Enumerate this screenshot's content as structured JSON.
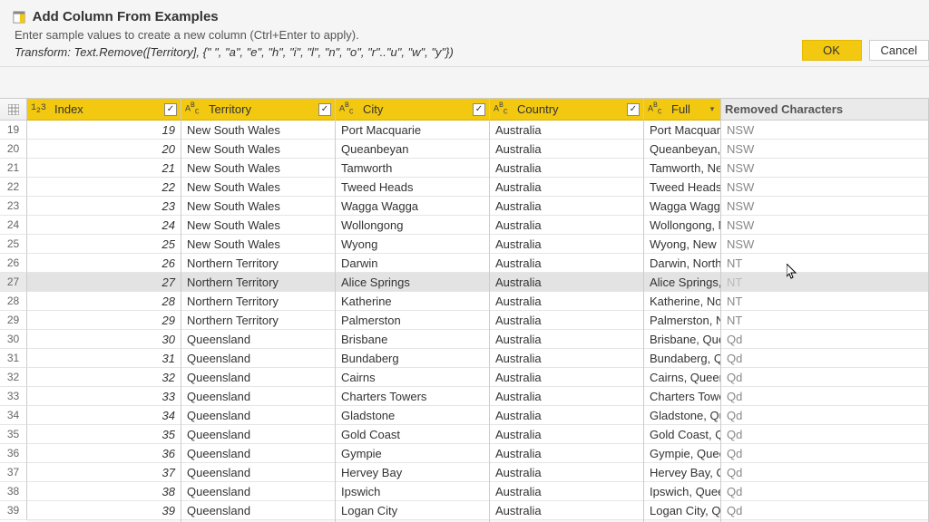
{
  "header": {
    "title": "Add Column From Examples",
    "subtitle": "Enter sample values to create a new column (Ctrl+Enter to apply).",
    "formula": "Transform: Text.Remove([Territory], {\" \", \"a\", \"e\", \"h\", \"i\", \"l\", \"n\", \"o\", \"r\"..\"u\", \"w\", \"y\"})"
  },
  "buttons": {
    "ok": "OK",
    "cancel": "Cancel"
  },
  "columns": {
    "index": {
      "label": "Index",
      "type": "123"
    },
    "terr": {
      "label": "Territory",
      "type": "ABC"
    },
    "city": {
      "label": "City",
      "type": "ABC"
    },
    "country": {
      "label": "Country",
      "type": "ABC"
    },
    "full": {
      "label": "Full",
      "type": "ABC"
    },
    "new": {
      "label": "Removed Characters"
    }
  },
  "chart_data": {
    "type": "table",
    "selected_row_index": 27,
    "rows": [
      {
        "n": 19,
        "idx": 19,
        "terr": "New South Wales",
        "city": "Port Macquarie",
        "country": "Australia",
        "full": "Port Macquarie",
        "new": "NSW"
      },
      {
        "n": 20,
        "idx": 20,
        "terr": "New South Wales",
        "city": "Queanbeyan",
        "country": "Australia",
        "full": "Queanbeyan, N",
        "new": "NSW"
      },
      {
        "n": 21,
        "idx": 21,
        "terr": "New South Wales",
        "city": "Tamworth",
        "country": "Australia",
        "full": "Tamworth, Ne",
        "new": "NSW"
      },
      {
        "n": 22,
        "idx": 22,
        "terr": "New South Wales",
        "city": "Tweed Heads",
        "country": "Australia",
        "full": "Tweed Heads,",
        "new": "NSW"
      },
      {
        "n": 23,
        "idx": 23,
        "terr": "New South Wales",
        "city": "Wagga Wagga",
        "country": "Australia",
        "full": "Wagga Wagga,",
        "new": "NSW"
      },
      {
        "n": 24,
        "idx": 24,
        "terr": "New South Wales",
        "city": "Wollongong",
        "country": "Australia",
        "full": "Wollongong, N",
        "new": "NSW"
      },
      {
        "n": 25,
        "idx": 25,
        "terr": "New South Wales",
        "city": "Wyong",
        "country": "Australia",
        "full": "Wyong, New S",
        "new": "NSW"
      },
      {
        "n": 26,
        "idx": 26,
        "terr": "Northern Territory",
        "city": "Darwin",
        "country": "Australia",
        "full": "Darwin, Northe",
        "new": "NT"
      },
      {
        "n": 27,
        "idx": 27,
        "terr": "Northern Territory",
        "city": "Alice Springs",
        "country": "Australia",
        "full": "Alice Springs, N",
        "new": "NT"
      },
      {
        "n": 28,
        "idx": 28,
        "terr": "Northern Territory",
        "city": "Katherine",
        "country": "Australia",
        "full": "Katherine, Nor",
        "new": "NT"
      },
      {
        "n": 29,
        "idx": 29,
        "terr": "Northern Territory",
        "city": "Palmerston",
        "country": "Australia",
        "full": "Palmerston, Ne",
        "new": "NT"
      },
      {
        "n": 30,
        "idx": 30,
        "terr": "Queensland",
        "city": "Brisbane",
        "country": "Australia",
        "full": "Brisbane, Quee",
        "new": "Qd"
      },
      {
        "n": 31,
        "idx": 31,
        "terr": "Queensland",
        "city": "Bundaberg",
        "country": "Australia",
        "full": "Bundaberg, Qu",
        "new": "Qd"
      },
      {
        "n": 32,
        "idx": 32,
        "terr": "Queensland",
        "city": "Cairns",
        "country": "Australia",
        "full": "Cairns, Queens",
        "new": "Qd"
      },
      {
        "n": 33,
        "idx": 33,
        "terr": "Queensland",
        "city": "Charters Towers",
        "country": "Australia",
        "full": "Charters Towe",
        "new": "Qd"
      },
      {
        "n": 34,
        "idx": 34,
        "terr": "Queensland",
        "city": "Gladstone",
        "country": "Australia",
        "full": "Gladstone, Qu",
        "new": "Qd"
      },
      {
        "n": 35,
        "idx": 35,
        "terr": "Queensland",
        "city": "Gold Coast",
        "country": "Australia",
        "full": "Gold Coast, Qu",
        "new": "Qd"
      },
      {
        "n": 36,
        "idx": 36,
        "terr": "Queensland",
        "city": "Gympie",
        "country": "Australia",
        "full": "Gympie, Quee",
        "new": "Qd"
      },
      {
        "n": 37,
        "idx": 37,
        "terr": "Queensland",
        "city": "Hervey Bay",
        "country": "Australia",
        "full": "Hervey Bay, Qu",
        "new": "Qd"
      },
      {
        "n": 38,
        "idx": 38,
        "terr": "Queensland",
        "city": "Ipswich",
        "country": "Australia",
        "full": "Ipswich, Queen",
        "new": "Qd"
      },
      {
        "n": 39,
        "idx": 39,
        "terr": "Queensland",
        "city": "Logan City",
        "country": "Australia",
        "full": "Logan City, Qu",
        "new": "Qd"
      }
    ]
  }
}
